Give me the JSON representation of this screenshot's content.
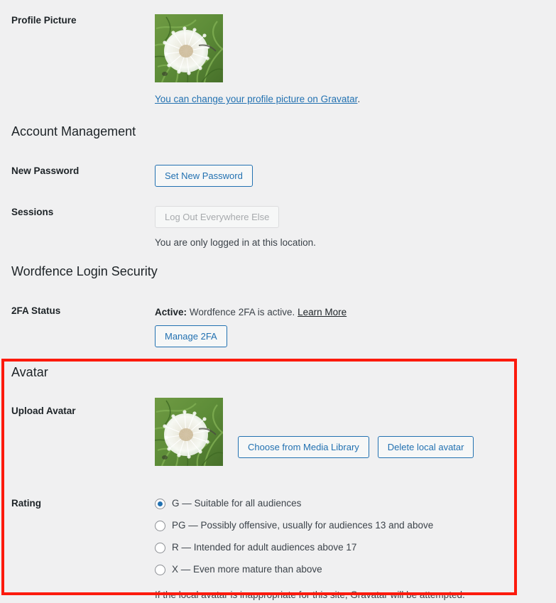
{
  "profile_picture": {
    "label": "Profile Picture",
    "avatar_alt": "dandelion-seed-head-avatar",
    "gravatar_link_text": "You can change your profile picture on Gravatar",
    "gravatar_link_suffix": "."
  },
  "account_management": {
    "heading": "Account Management",
    "new_password": {
      "label": "New Password",
      "button_label": "Set New Password"
    },
    "sessions": {
      "label": "Sessions",
      "button_label": "Log Out Everywhere Else",
      "button_disabled": true,
      "description": "You are only logged in at this location."
    }
  },
  "wordfence": {
    "heading": "Wordfence Login Security",
    "twofa_status": {
      "label": "2FA Status",
      "status_prefix": "Active:",
      "status_text": "Wordfence 2FA is active.",
      "learn_more_label": "Learn More",
      "button_label": "Manage 2FA"
    }
  },
  "avatar": {
    "heading": "Avatar",
    "upload_avatar": {
      "label": "Upload Avatar",
      "avatar_alt": "dandelion-seed-head-avatar",
      "choose_button_label": "Choose from Media Library",
      "delete_button_label": "Delete local avatar"
    },
    "rating": {
      "label": "Rating",
      "options": [
        {
          "value": "G",
          "label": "G — Suitable for all audiences",
          "checked": true
        },
        {
          "value": "PG",
          "label": "PG — Possibly offensive, usually for audiences 13 and above",
          "checked": false
        },
        {
          "value": "R",
          "label": "R — Intended for adult audiences above 17",
          "checked": false
        },
        {
          "value": "X",
          "label": "X — Even more mature than above",
          "checked": false
        }
      ],
      "description": "If the local avatar is inappropriate for this site, Gravatar will be attempted."
    }
  },
  "colors": {
    "page_background": "#f0f0f1",
    "accent_blue": "#2271b1",
    "heading_text": "#1d2327",
    "body_text": "#3c434a",
    "highlight_red": "#fc1a0d",
    "disabled_text": "#a7aaad"
  }
}
